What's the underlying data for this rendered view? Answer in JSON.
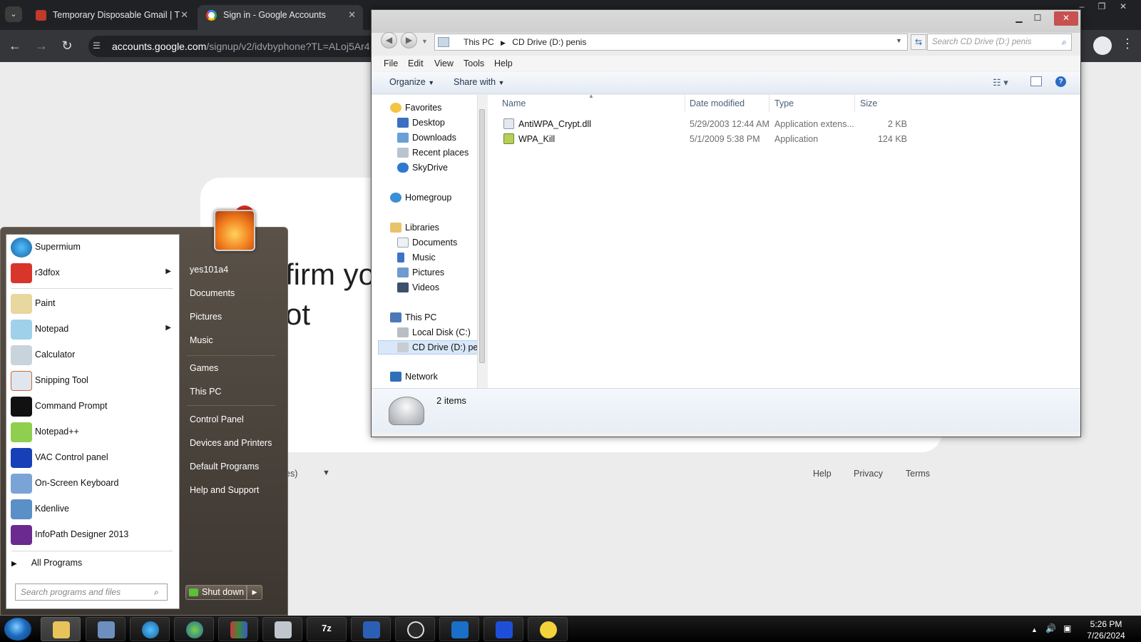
{
  "browser": {
    "tabs": [
      {
        "label": "Temporary Disposable Gmail | T"
      },
      {
        "label": "Sign in - Google Accounts"
      }
    ],
    "url_host": "accounts.google.com",
    "url_path": "/signup/v2/idvbyphone?TL=ALoj5Ar4",
    "page": {
      "heading_line1": "firm yo",
      "heading_line2": "ot",
      "language_fragment": "es)",
      "footer_links": [
        "Help",
        "Privacy",
        "Terms"
      ]
    }
  },
  "explorer": {
    "address_crumbs": [
      "This PC",
      "CD Drive (D:) penis"
    ],
    "search_placeholder": "Search CD Drive (D:) penis",
    "menu": [
      "File",
      "Edit",
      "View",
      "Tools",
      "Help"
    ],
    "commands": {
      "organize": "Organize",
      "share_with": "Share with"
    },
    "nav_tree": {
      "favorites": {
        "label": "Favorites",
        "items": [
          "Desktop",
          "Downloads",
          "Recent places",
          "SkyDrive"
        ]
      },
      "homegroup": "Homegroup",
      "libraries": {
        "label": "Libraries",
        "items": [
          "Documents",
          "Music",
          "Pictures",
          "Videos"
        ]
      },
      "this_pc": {
        "label": "This PC",
        "items": [
          "Local Disk (C:)",
          "CD Drive (D:) pen"
        ]
      },
      "network": "Network"
    },
    "columns": [
      "Name",
      "Date modified",
      "Type",
      "Size"
    ],
    "files": [
      {
        "name": "AntiWPA_Crypt.dll",
        "date": "5/29/2003 12:44 AM",
        "type": "Application extens...",
        "size": "2 KB"
      },
      {
        "name": "WPA_Kill",
        "date": "5/1/2009 5:38 PM",
        "type": "Application",
        "size": "124 KB"
      }
    ],
    "status": "2 items"
  },
  "start_menu": {
    "programs": [
      {
        "label": "Supermium",
        "has_submenu": false
      },
      {
        "label": "r3dfox",
        "has_submenu": true
      },
      {
        "label": "Paint",
        "has_submenu": false
      },
      {
        "label": "Notepad",
        "has_submenu": true
      },
      {
        "label": "Calculator",
        "has_submenu": false
      },
      {
        "label": "Snipping Tool",
        "has_submenu": false
      },
      {
        "label": "Command Prompt",
        "has_submenu": false
      },
      {
        "label": "Notepad++",
        "has_submenu": false
      },
      {
        "label": "VAC Control panel",
        "has_submenu": false
      },
      {
        "label": "On-Screen Keyboard",
        "has_submenu": false
      },
      {
        "label": "Kdenlive",
        "has_submenu": false
      },
      {
        "label": "InfoPath Designer 2013",
        "has_submenu": false
      }
    ],
    "all_programs": "All Programs",
    "search_placeholder": "Search programs and files",
    "right_items": [
      "yes101a4",
      "Documents",
      "Pictures",
      "Music",
      "Games",
      "This PC",
      "Control Panel",
      "Devices and Printers",
      "Default Programs",
      "Help and Support"
    ],
    "shutdown_label": "Shut down"
  },
  "taskbar": {
    "pinned_labels": [
      "7z"
    ],
    "time": "5:26 PM",
    "date": "7/26/2024"
  },
  "colors": {
    "accent_blue": "#1e3148",
    "start_menu_bg": "#4a433c",
    "taskbar_bg": "#000000"
  }
}
